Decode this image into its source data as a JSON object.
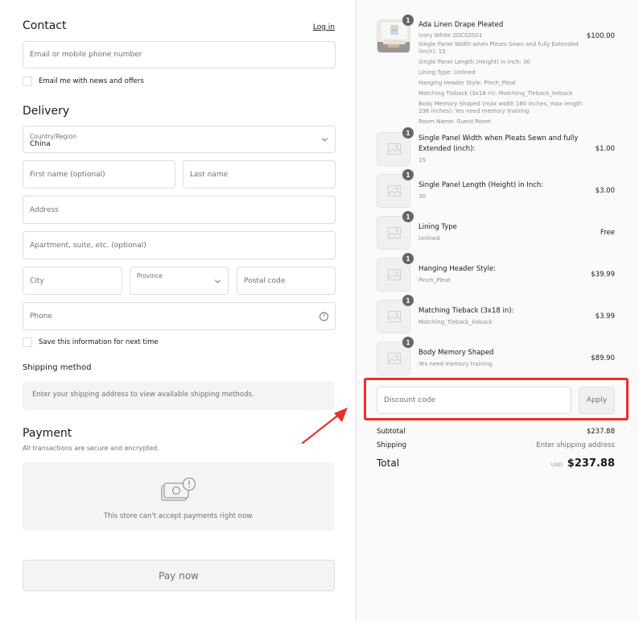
{
  "contact": {
    "heading": "Contact",
    "login_label": "Log in",
    "email_placeholder": "Email or mobile phone number",
    "news_checkbox_label": "Email me with news and offers"
  },
  "delivery": {
    "heading": "Delivery",
    "country_label": "Country/Region",
    "country_value": "China",
    "first_name_placeholder": "First name (optional)",
    "last_name_placeholder": "Last name",
    "address_placeholder": "Address",
    "apartment_placeholder": "Apartment, suite, etc. (optional)",
    "city_placeholder": "City",
    "province_label": "Province",
    "postal_placeholder": "Postal code",
    "phone_placeholder": "Phone",
    "help_glyph": "?",
    "save_checkbox_label": "Save this information for next time"
  },
  "shipping_method": {
    "heading": "Shipping method",
    "notice": "Enter your shipping address to view available shipping methods."
  },
  "payment": {
    "heading": "Payment",
    "subtitle": "All transactions are secure and encrypted.",
    "notice": "This store can't accept payments right now.",
    "icon": "cash-warning-icon"
  },
  "pay_button_label": "Pay now",
  "order": {
    "items": [
      {
        "quantity": "1",
        "title": "Ada Linen Drape Pleated",
        "variant": "Ivory White 2DC02501",
        "properties": [
          "Single Panel Width when Pleats Sewn and fully Extended (inch): 15",
          "Single Panel Length (Height) in Inch: 30",
          "Lining Type: Unlined",
          "Hanging Header Style: Pinch_Pleat",
          "Matching Tieback  (3x18 in): Matching_Tieback_tieback",
          "Body Memory Shaped (max width 160 inches, max length 236 inches): Yes need memory training",
          "Room Name: Guest Room"
        ],
        "price": "$100.00",
        "image": "curtain-room-photo"
      },
      {
        "quantity": "1",
        "title": "Single Panel Width when Pleats Sewn and fully Extended (inch):",
        "subtitle": "15",
        "price": "$1.00",
        "image": "image-placeholder-icon"
      },
      {
        "quantity": "1",
        "title": "Single Panel Length (Height) in Inch:",
        "subtitle": "30",
        "price": "$3.00",
        "image": "image-placeholder-icon"
      },
      {
        "quantity": "1",
        "title": "Lining Type",
        "subtitle": "Unlined",
        "price": "Free",
        "image": "image-placeholder-icon"
      },
      {
        "quantity": "1",
        "title": "Hanging Header Style:",
        "subtitle": "Pinch_Pleat",
        "price": "$39.99",
        "image": "image-placeholder-icon"
      },
      {
        "quantity": "1",
        "title": "Matching Tieback  (3x18 in):",
        "subtitle": "Matching_Tieback_tieback",
        "price": "$3.99",
        "image": "image-placeholder-icon"
      },
      {
        "quantity": "1",
        "title": "Body Memory Shaped",
        "subtitle": "Yes need memory training",
        "price": "$89.90",
        "image": "image-placeholder-icon"
      }
    ],
    "discount_placeholder": "Discount code",
    "apply_label": "Apply",
    "subtotal_label": "Subtotal",
    "subtotal_value": "$237.88",
    "shipping_label": "Shipping",
    "shipping_value": "Enter shipping address",
    "total_label": "Total",
    "currency": "USD",
    "total_value": "$237.88"
  },
  "annotation": {
    "highlight_color": "#e8302a",
    "arrow_color": "#e8302a"
  }
}
